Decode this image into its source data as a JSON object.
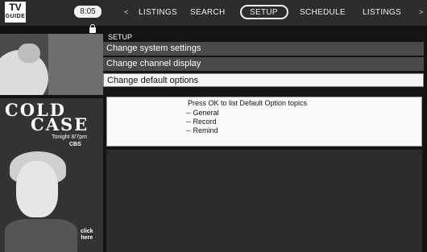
{
  "brand": {
    "logo_line1": "TV",
    "logo_line2": "GUIDE"
  },
  "clock": "8:05",
  "nav": {
    "left_arrow": "<",
    "items": [
      "LISTINGS",
      "SEARCH",
      "SETUP",
      "SCHEDULE",
      "LISTINGS"
    ],
    "right_arrow": ">",
    "active_index": 2
  },
  "ad": {
    "title_line1": "COLD",
    "title_line2": "CASE",
    "time": "Tonight 8/7pm",
    "network": "CBS",
    "cta_line1": "click",
    "cta_line2": "here"
  },
  "menu": {
    "breadcrumb": "SETUP",
    "options": [
      "Change system settings",
      "Change channel display",
      "Change default options"
    ],
    "selected_index": 2
  },
  "info_panel": {
    "header": "Press OK to list Default Option topics",
    "topics": [
      "-- General",
      "-- Record",
      "-- Remind"
    ]
  }
}
